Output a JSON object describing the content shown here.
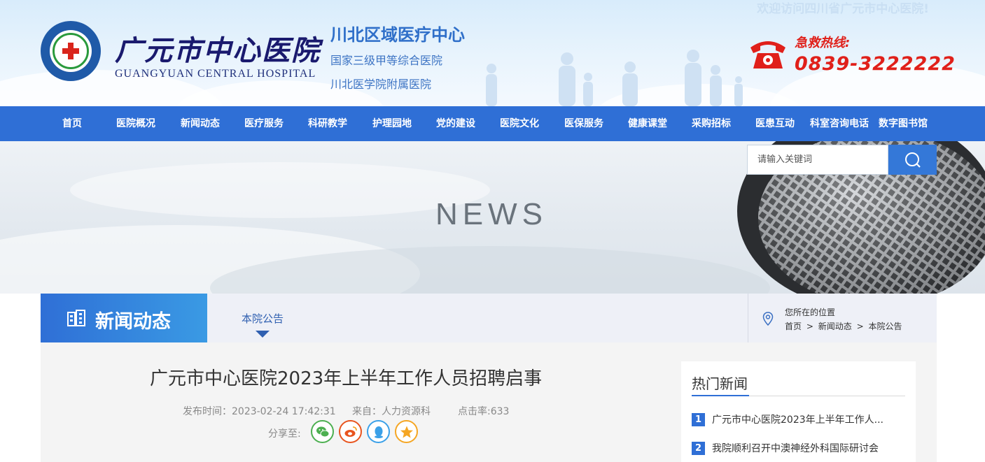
{
  "header": {
    "hospital_name_cn": "广元市中心医院",
    "hospital_name_en": "GUANGYUAN CENTRAL HOSPITAL",
    "region_title": "川北区域医疗中心",
    "region_sub1": "国家三级甲等综合医院",
    "region_sub2": "川北医学院附属医院",
    "welcome": "欢迎访问四川省广元市中心医院!",
    "hotline_label": "急救热线:",
    "hotline_number": "0839-3222222"
  },
  "nav": {
    "items": [
      "首页",
      "医院概况",
      "新闻动态",
      "医疗服务",
      "科研教学",
      "护理园地",
      "党的建设",
      "医院文化",
      "医保服务",
      "健康课堂",
      "采购招标",
      "医患互动",
      "科室咨询电话",
      "数字图书馆"
    ]
  },
  "banner": {
    "word": "NEWS",
    "search_placeholder": "请输入关键词"
  },
  "section": {
    "title": "新闻动态",
    "tab": "本院公告",
    "location_label": "您所在的位置",
    "breadcrumb": [
      "首页",
      ">",
      "新闻动态",
      ">",
      "本院公告"
    ]
  },
  "article": {
    "title": "广元市中心医院2023年上半年工作人员招聘启事",
    "publish_time": "发布时间：2023-02-24 17:42:31",
    "source": "来自：人力资源科",
    "clicks": "点击率:633",
    "share_label": "分享至:"
  },
  "hot_news": {
    "title": "热门新闻",
    "items": [
      {
        "num": "1",
        "text": "广元市中心医院2023年上半年工作人..."
      },
      {
        "num": "2",
        "text": "我院顺利召开中澳神经外科国际研讨会"
      }
    ]
  },
  "colors": {
    "nav": "#2f6fd6",
    "hotline": "#e0201a",
    "accent": "#3478d8"
  }
}
